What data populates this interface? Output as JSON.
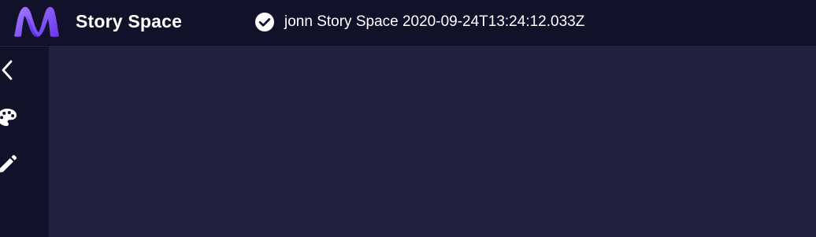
{
  "header": {
    "app_title": "Story Space",
    "status_text": "jonn Story Space 2020-09-24T13:24:12.033Z",
    "status_icon": "check-circle-icon"
  },
  "sidebar": {
    "items": [
      {
        "icon": "chevron-left-icon"
      },
      {
        "icon": "palette-icon"
      },
      {
        "icon": "pencil-icon"
      }
    ]
  },
  "colors": {
    "topbar_bg": "#11112a",
    "sidebar_bg": "#11112a",
    "content_bg": "#22223f",
    "logo_gradient_start": "#8b6cff",
    "logo_gradient_end": "#5b2ee8",
    "text": "#ffffff"
  }
}
